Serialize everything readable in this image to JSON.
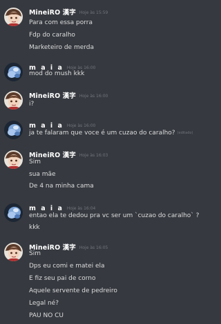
{
  "colors": {
    "background": "#36393f",
    "username": "#ffffff",
    "message_text": "#dcddde",
    "timestamp": "#72767d"
  },
  "icons": {
    "mineiro_avatar": "anime-character-avatar",
    "maia_avatar": "blue-blob-avatar"
  },
  "messages": [
    {
      "author": "MineiRO 漢字",
      "timestamp": "Hoje às 15:59",
      "lines": [
        "Para com essa porra",
        "Fdp do caralho",
        "Marketeiro de merda"
      ]
    },
    {
      "author": "m a i a",
      "timestamp": "Hoje às 16:00",
      "lines": [
        "mod do mush kkk"
      ]
    },
    {
      "author": "MineiRO 漢字",
      "timestamp": "Hoje às 16:00",
      "lines": [
        "i?"
      ]
    },
    {
      "author": "m a i a",
      "timestamp": "Hoje às 16:00",
      "lines": [
        "ja te falaram que voce é um cuzao do caralho?"
      ],
      "edited_label": "(editado)"
    },
    {
      "author": "MineiRO 漢字",
      "timestamp": "Hoje às 16:03",
      "lines": [
        "Sim",
        "sua mãe",
        "De 4 na minha cama"
      ]
    },
    {
      "author": "m a i a",
      "timestamp": "Hoje às 16:04",
      "lines": [
        "entao ela te dedou pra vc ser um `cuzao do caralho` ?",
        "kkk"
      ]
    },
    {
      "author": "MineiRO 漢字",
      "timestamp": "Hoje às 16:05",
      "lines": [
        "Sim",
        "Dps eu comi e matei ela",
        "E fiz seu pai de corno",
        "Aquele servente de pedreiro",
        "Legal né?",
        "PAU NO CU"
      ]
    }
  ]
}
